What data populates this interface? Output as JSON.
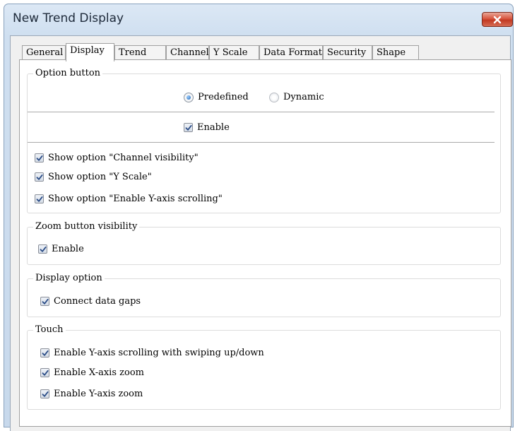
{
  "window": {
    "title": "New Trend Display"
  },
  "tabs": [
    {
      "label": "General"
    },
    {
      "label": "Display",
      "active": true
    },
    {
      "label": "Trend"
    },
    {
      "label": "Channel"
    },
    {
      "label": "Y Scale"
    },
    {
      "label": "Data Format"
    },
    {
      "label": "Security"
    },
    {
      "label": "Shape"
    }
  ],
  "option_button": {
    "legend": "Option button",
    "mode_options": [
      {
        "label": "Predefined",
        "selected": true
      },
      {
        "label": "Dynamic",
        "selected": false
      }
    ],
    "enable": {
      "label": "Enable",
      "checked": true
    },
    "show_options": [
      {
        "label": "Show option \"Channel visibility\"",
        "checked": true
      },
      {
        "label": "Show option \"Y Scale\"",
        "checked": true
      },
      {
        "label": "Show option \"Enable Y-axis scrolling\"",
        "checked": true
      }
    ]
  },
  "zoom_button": {
    "legend": "Zoom button visibility",
    "enable": {
      "label": "Enable",
      "checked": true
    }
  },
  "display_option": {
    "legend": "Display option",
    "connect_gaps": {
      "label": "Connect data gaps",
      "checked": true
    }
  },
  "touch": {
    "legend": "Touch",
    "items": [
      {
        "label": "Enable Y-axis scrolling with swiping up/down",
        "checked": true
      },
      {
        "label": "Enable X-axis zoom",
        "checked": true
      },
      {
        "label": "Enable Y-axis zoom",
        "checked": true
      }
    ]
  },
  "colors": {
    "close_button": "#d8553f",
    "check_mark": "#2a4c86",
    "radio_selected": "#1b5fae"
  }
}
